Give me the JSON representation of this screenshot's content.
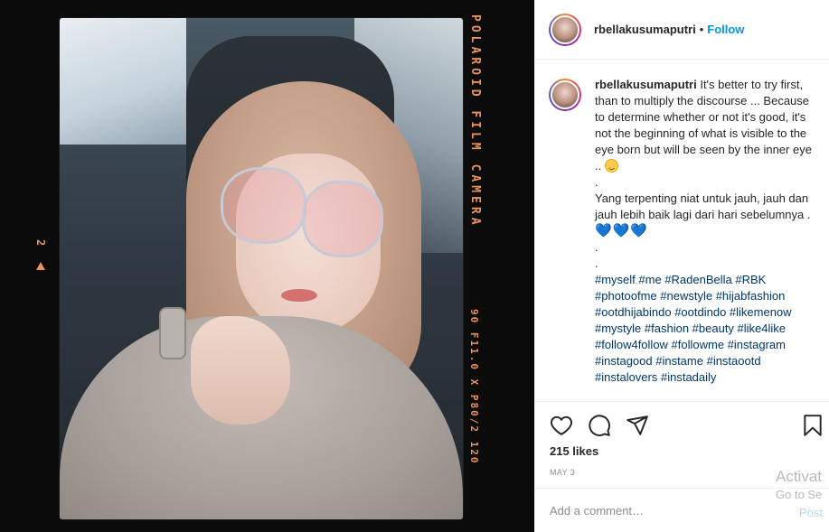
{
  "post": {
    "username": "rbellakusumaputri",
    "follow_label": "Follow",
    "dot": "•",
    "caption_username": "rbellakusumaputri",
    "caption_p1": "It's better to try first, than to multiply the discourse ... Because to determine whether or not it's good, it's not the beginning of what is visible to the eye born but will be seen by the inner eye ..",
    "caption_dot1": ".",
    "caption_p2": "Yang terpenting niat untuk jauh, jauh dan jauh lebih baik lagi dari hari sebelumnya .",
    "caption_hearts": "💙💙💙",
    "caption_dot2": ".",
    "caption_dot3": ".",
    "hashtags": "#myself #me #RadenBella #RBK #photoofme #newstyle #hijabfashion #ootdhijabindo #ootdindo #likemenow #mystyle #fashion #beauty #like4like #follow4follow #followme #instagram #instagood #instame #instaootd #instalovers #instadaily",
    "likes": "215 likes",
    "date": "MAY 3",
    "comment_placeholder": "Add a comment…",
    "post_label": "Post"
  },
  "photo": {
    "film_side_text": "POLAROID FILM CAMERA",
    "film_side_text2": "90 F11.0 X P80/2 120",
    "film_frame_number": "2"
  },
  "overlay": {
    "activate_line1": "Activat",
    "activate_line2": "Go to Se"
  },
  "icons": {
    "like": "heart-icon",
    "comment": "comment-icon",
    "share": "share-icon",
    "save": "bookmark-icon"
  },
  "colors": {
    "accent": "#0095f6",
    "film_text": "#e9925a",
    "hashtag": "#00376b"
  }
}
